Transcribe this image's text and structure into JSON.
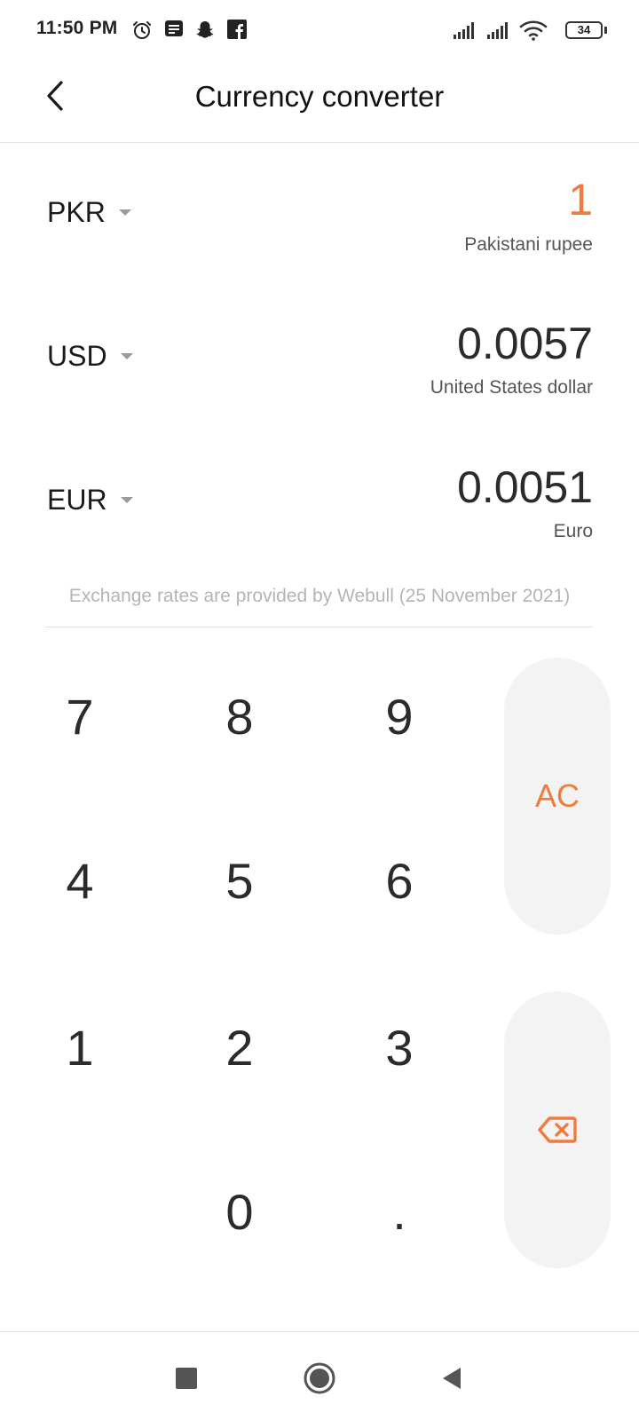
{
  "status_bar": {
    "time": "11:50 PM",
    "left_icons": [
      "alarm-icon",
      "message-icon",
      "snapchat-icon",
      "facebook-icon"
    ],
    "right_icons": [
      "signal-icon",
      "signal-icon",
      "wifi-icon",
      "battery-icon"
    ],
    "battery_level": "34"
  },
  "header": {
    "title": "Currency converter",
    "back_icon": "chevron-left-icon"
  },
  "currencies": [
    {
      "code": "PKR",
      "value": "1",
      "name": "Pakistani rupee",
      "active": true
    },
    {
      "code": "USD",
      "value": "0.0057",
      "name": "United States dollar",
      "active": false
    },
    {
      "code": "EUR",
      "value": "0.0051",
      "name": "Euro",
      "active": false
    }
  ],
  "rates_note": "Exchange rates are provided by Webull (25 November 2021)",
  "keypad": {
    "keys": [
      "7",
      "8",
      "9",
      "4",
      "5",
      "6",
      "1",
      "2",
      "3",
      "0",
      "."
    ],
    "clear_label": "AC",
    "backspace_icon": "backspace-icon"
  },
  "colors": {
    "accent": "#f07b3f",
    "key_background": "#f3f3f3",
    "text_primary": "#1f1f1f",
    "text_secondary": "#555555",
    "text_muted": "#b4b4b4"
  },
  "nav_bar": {
    "icons": [
      "recents-icon",
      "home-icon",
      "back-icon"
    ]
  }
}
